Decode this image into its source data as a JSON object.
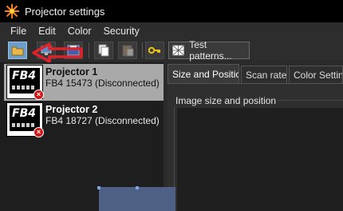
{
  "window": {
    "title": "Projector settings"
  },
  "menu": [
    "File",
    "Edit",
    "Color",
    "Security"
  ],
  "toolbar": {
    "buttons": [
      {
        "icon": "open-folder-icon"
      },
      {
        "icon": "network-icon"
      },
      {
        "icon": "save-icon"
      },
      {
        "icon": "copy-icon"
      },
      {
        "icon": "paste-icon"
      },
      {
        "icon": "key-icon"
      }
    ],
    "test_patterns_label": "Test patterns..."
  },
  "devices": [
    {
      "name": "Projector 1",
      "status": "FB4 15473 (Disconnected)",
      "badge": "FB4",
      "selected": true
    },
    {
      "name": "Projector 2",
      "status": "FB4 18727 (Disconnected)",
      "badge": "FB4",
      "selected": false
    }
  ],
  "tabs": [
    {
      "label": "Size and Position",
      "active": true
    },
    {
      "label": "Scan rate",
      "active": false
    },
    {
      "label": "Color Settings",
      "active": false
    }
  ],
  "panel": {
    "group_label": "Image size and position"
  },
  "colors": {
    "accent": "#6c9ec9",
    "annotation": "#e0202a",
    "error": "#d01818"
  }
}
